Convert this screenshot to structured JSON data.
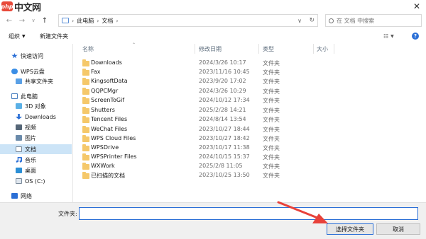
{
  "watermark": {
    "logo_text": "php",
    "text": "中文网"
  },
  "window": {
    "close_glyph": "✕"
  },
  "nav": {
    "back_glyph": "←",
    "forward_glyph": "→",
    "recent_glyph": "∨",
    "up_glyph": "↑"
  },
  "address": {
    "segments": [
      "此电脑",
      "文档"
    ],
    "separator": "›"
  },
  "search": {
    "placeholder": "在 文档 中搜索"
  },
  "toolbar": {
    "organize_label": "组织",
    "new_folder_label": "新建文件夹"
  },
  "sidebar": {
    "items": [
      {
        "label": "快速访问",
        "icon": "quick-access-icon",
        "color": "#2b6fd6"
      },
      {
        "label": "WPS云盘",
        "icon": "cloud-icon",
        "color": "#3a8ee6"
      },
      {
        "label": "共享文件夹",
        "icon": "shared-folder-icon",
        "color": "#5aa0e6"
      },
      {
        "label": "此电脑",
        "icon": "computer-icon",
        "color": "#4a7fbf"
      },
      {
        "label": "3D 对象",
        "icon": "3d-objects-icon",
        "color": "#5ab0e6"
      },
      {
        "label": "Downloads",
        "icon": "download-icon",
        "color": "#2b6fd6"
      },
      {
        "label": "视频",
        "icon": "video-icon",
        "color": "#556677"
      },
      {
        "label": "图片",
        "icon": "pictures-icon",
        "color": "#6a8aaa"
      },
      {
        "label": "文档",
        "icon": "documents-icon",
        "color": "#7a8a9a"
      },
      {
        "label": "音乐",
        "icon": "music-icon",
        "color": "#2b6fd6"
      },
      {
        "label": "桌面",
        "icon": "desktop-icon",
        "color": "#2b8fd6"
      },
      {
        "label": "OS (C:)",
        "icon": "drive-icon",
        "color": "#7a8a9a"
      },
      {
        "label": "网络",
        "icon": "network-icon",
        "color": "#2b6fd6"
      }
    ]
  },
  "columns": {
    "name": "名称",
    "date": "修改日期",
    "type": "类型",
    "size": "大小"
  },
  "files": [
    {
      "name": "Downloads",
      "date": "2024/3/26 10:17",
      "type": "文件夹"
    },
    {
      "name": "Fax",
      "date": "2023/11/16 10:45",
      "type": "文件夹"
    },
    {
      "name": "KingsoftData",
      "date": "2023/9/20 17:02",
      "type": "文件夹"
    },
    {
      "name": "QQPCMgr",
      "date": "2024/3/26 10:29",
      "type": "文件夹"
    },
    {
      "name": "ScreenToGif",
      "date": "2024/10/12 17:34",
      "type": "文件夹"
    },
    {
      "name": "Shutters",
      "date": "2025/2/28 14:21",
      "type": "文件夹"
    },
    {
      "name": "Tencent Files",
      "date": "2024/8/14 13:54",
      "type": "文件夹"
    },
    {
      "name": "WeChat Files",
      "date": "2023/10/27 18:44",
      "type": "文件夹"
    },
    {
      "name": "WPS Cloud Files",
      "date": "2023/10/27 18:42",
      "type": "文件夹"
    },
    {
      "name": "WPSDrive",
      "date": "2023/10/17 11:38",
      "type": "文件夹"
    },
    {
      "name": "WPSPrinter Files",
      "date": "2024/10/15 15:37",
      "type": "文件夹"
    },
    {
      "name": "WXWork",
      "date": "2025/2/8 11:05",
      "type": "文件夹"
    },
    {
      "name": "已扫描的文档",
      "date": "2023/10/25 13:50",
      "type": "文件夹"
    }
  ],
  "footer": {
    "folder_label": "文件夹:",
    "folder_value": "",
    "select_button": "选择文件夹",
    "cancel_button": "取消"
  },
  "colors": {
    "accent": "#2b6fd6",
    "selected_bg": "#cce4f7",
    "annotation_arrow": "#e8413a"
  }
}
